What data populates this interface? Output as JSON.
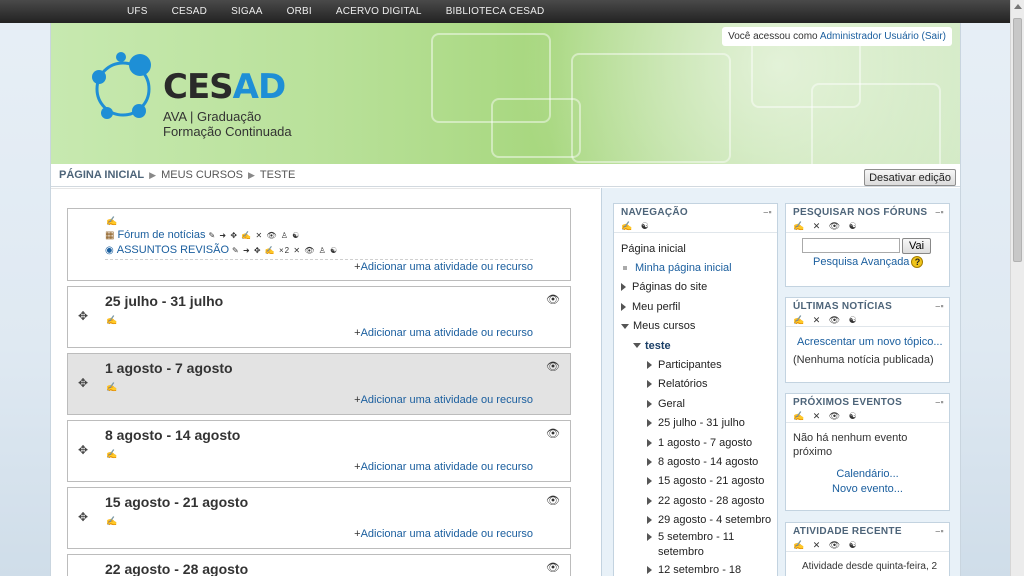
{
  "topnav": [
    "UFS",
    "CESAD",
    "SIGAA",
    "ORBI",
    "ACERVO DIGITAL",
    "BIBLIOTECA CESAD"
  ],
  "header": {
    "logo_text_1": "CES",
    "logo_text_2": "AD",
    "subtitle_1": "AVA | Graduação",
    "subtitle_2": "Formação Continuada",
    "login_prefix": "Você acessou como",
    "login_user": "Administrador Usuário",
    "login_logout": "(Sair)"
  },
  "breadcrumb": [
    "PÁGINA INICIAL",
    "MEUS CURSOS",
    "TESTE"
  ],
  "edit_button": "Desativar edição",
  "topic0": {
    "activities": [
      {
        "icon": "forum-icon",
        "label": "Fórum de notícias",
        "controls": "✎ ➜ ✥ ✍ ✕ 👁 ♙ ☯"
      },
      {
        "icon": "globe-icon",
        "label": "ASSUNTOS REVISÃO",
        "controls": "✎ ➜ ✥ ✍ ×2 ✕ 👁 ♙ ☯"
      }
    ],
    "add_label": "Adicionar uma atividade ou recurso"
  },
  "sections": [
    {
      "title": "25 julho - 31 julho",
      "add_label": "Adicionar uma atividade ou recurso"
    },
    {
      "title": "1 agosto - 7 agosto",
      "add_label": "Adicionar uma atividade ou recurso"
    },
    {
      "title": "8 agosto - 14 agosto",
      "add_label": "Adicionar uma atividade ou recurso"
    },
    {
      "title": "15 agosto - 21 agosto",
      "add_label": "Adicionar uma atividade ou recurso"
    },
    {
      "title": "22 agosto - 28 agosto"
    }
  ],
  "navigation": {
    "title": "NAVEGAÇÃO",
    "items": [
      "Página inicial",
      "Minha página inicial",
      "Páginas do site",
      "Meu perfil",
      "Meus cursos",
      "teste",
      "Participantes",
      "Relatórios",
      "Geral",
      "25 julho - 31 julho",
      "1 agosto - 7 agosto",
      "8 agosto - 14 agosto",
      "15 agosto - 21 agosto",
      "22 agosto - 28 agosto",
      "29 agosto - 4 setembro",
      "5 setembro - 11",
      "setembro",
      "12 setembro - 18"
    ]
  },
  "forum_search": {
    "title": "PESQUISAR NOS FÓRUNS",
    "button": "Vai",
    "advanced": "Pesquisa Avançada",
    "help": "?"
  },
  "news": {
    "title": "ÚLTIMAS NOTÍCIAS",
    "add_topic": "Acrescentar um novo tópico...",
    "empty": "(Nenhuma notícia publicada)"
  },
  "events": {
    "title": "PRÓXIMOS EVENTOS",
    "empty_1": "Não há nenhum evento",
    "empty_2": "próximo",
    "calendar": "Calendário...",
    "new_event": "Novo evento..."
  },
  "recent": {
    "title": "ATIVIDADE RECENTE",
    "text": "Atividade desde quinta-feira, 2"
  },
  "block_icons": "✍ ✕ 👁 ☯",
  "block_icons_small": "✍ ☯"
}
